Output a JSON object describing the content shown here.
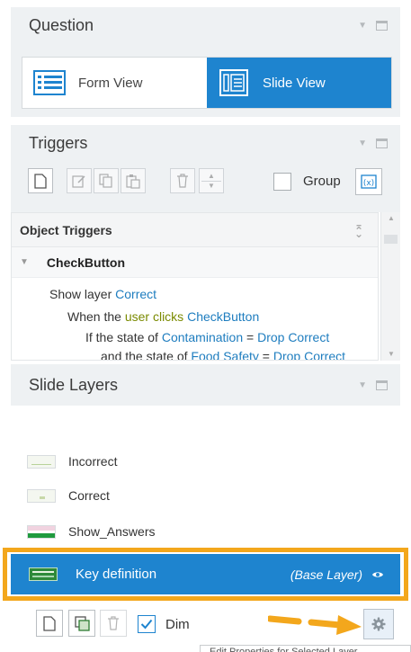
{
  "question": {
    "title": "Question",
    "views": [
      {
        "label": "Form View",
        "active": false,
        "icon": "form-view-icon"
      },
      {
        "label": "Slide View",
        "active": true,
        "icon": "slide-view-icon"
      }
    ]
  },
  "triggers": {
    "title": "Triggers",
    "group_label": "Group",
    "group_checked": false
  },
  "object_triggers": {
    "header": "Object Triggers",
    "item": "CheckButton",
    "lines": {
      "l1_action": "Show layer ",
      "l1_target": "Correct",
      "l2_pre": "When the ",
      "l2_user": "user clicks",
      "l2_space": " ",
      "l2_obj": "CheckButton",
      "l3_pre": "If the state of ",
      "l3_obj": "Contamination",
      "l3_eq": " = ",
      "l3_val": "Drop Correct",
      "l4_pre": "and the state of ",
      "l4_obj": "Food Safety",
      "l4_eq": " = ",
      "l4_val": "Drop Correct"
    }
  },
  "slide_layers": {
    "title": "Slide Layers",
    "layers": [
      {
        "name": "Incorrect"
      },
      {
        "name": "Correct"
      },
      {
        "name": "Show_Answers"
      }
    ],
    "base": {
      "name": "Key definition",
      "tag": "(Base Layer)"
    },
    "dim_label": "Dim",
    "dim_checked": true
  },
  "tooltip": "Edit Properties for Selected Layer",
  "colors": {
    "accent": "#1e84cf",
    "highlight": "#f3a71c"
  }
}
